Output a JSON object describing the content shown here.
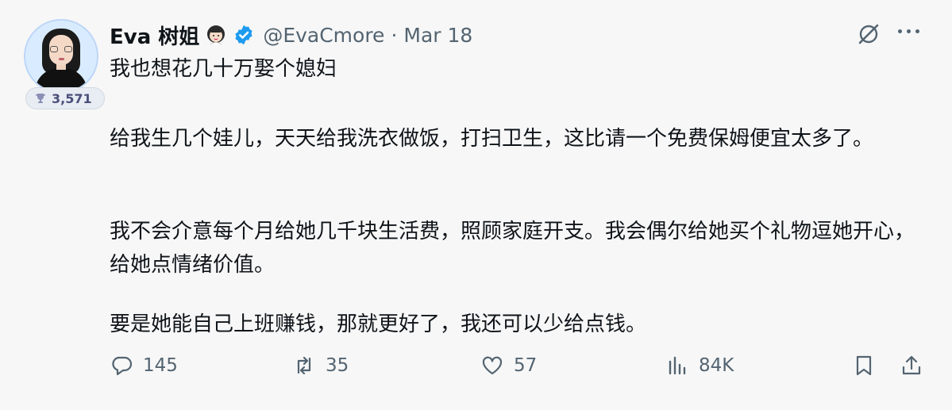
{
  "author": {
    "display_name": "Eva 树姐",
    "handle": "@EvaCmore",
    "separator": "·",
    "date": "Mar 18",
    "rank_count": "3,571"
  },
  "tweet": {
    "line1": "我也想花几十万娶个媳妇",
    "para1": "给我生几个娃儿，天天给我洗衣做饭，打扫卫生，这比请一个免费保姆便宜太多了。",
    "para2": "我不会介意每个月给她几千块生活费，照顾家庭开支。我会偶尔给她买个礼物逗她开心，给她点情绪价值。",
    "para3": "要是她能自己上班赚钱，那就更好了，我还可以少给点钱。"
  },
  "actions": {
    "replies": "145",
    "retweets": "35",
    "likes": "57",
    "views": "84K"
  },
  "colors": {
    "text": "#0f1419",
    "muted": "#536471",
    "verified": "#1d9bf0",
    "background": "#f7f7f7"
  }
}
